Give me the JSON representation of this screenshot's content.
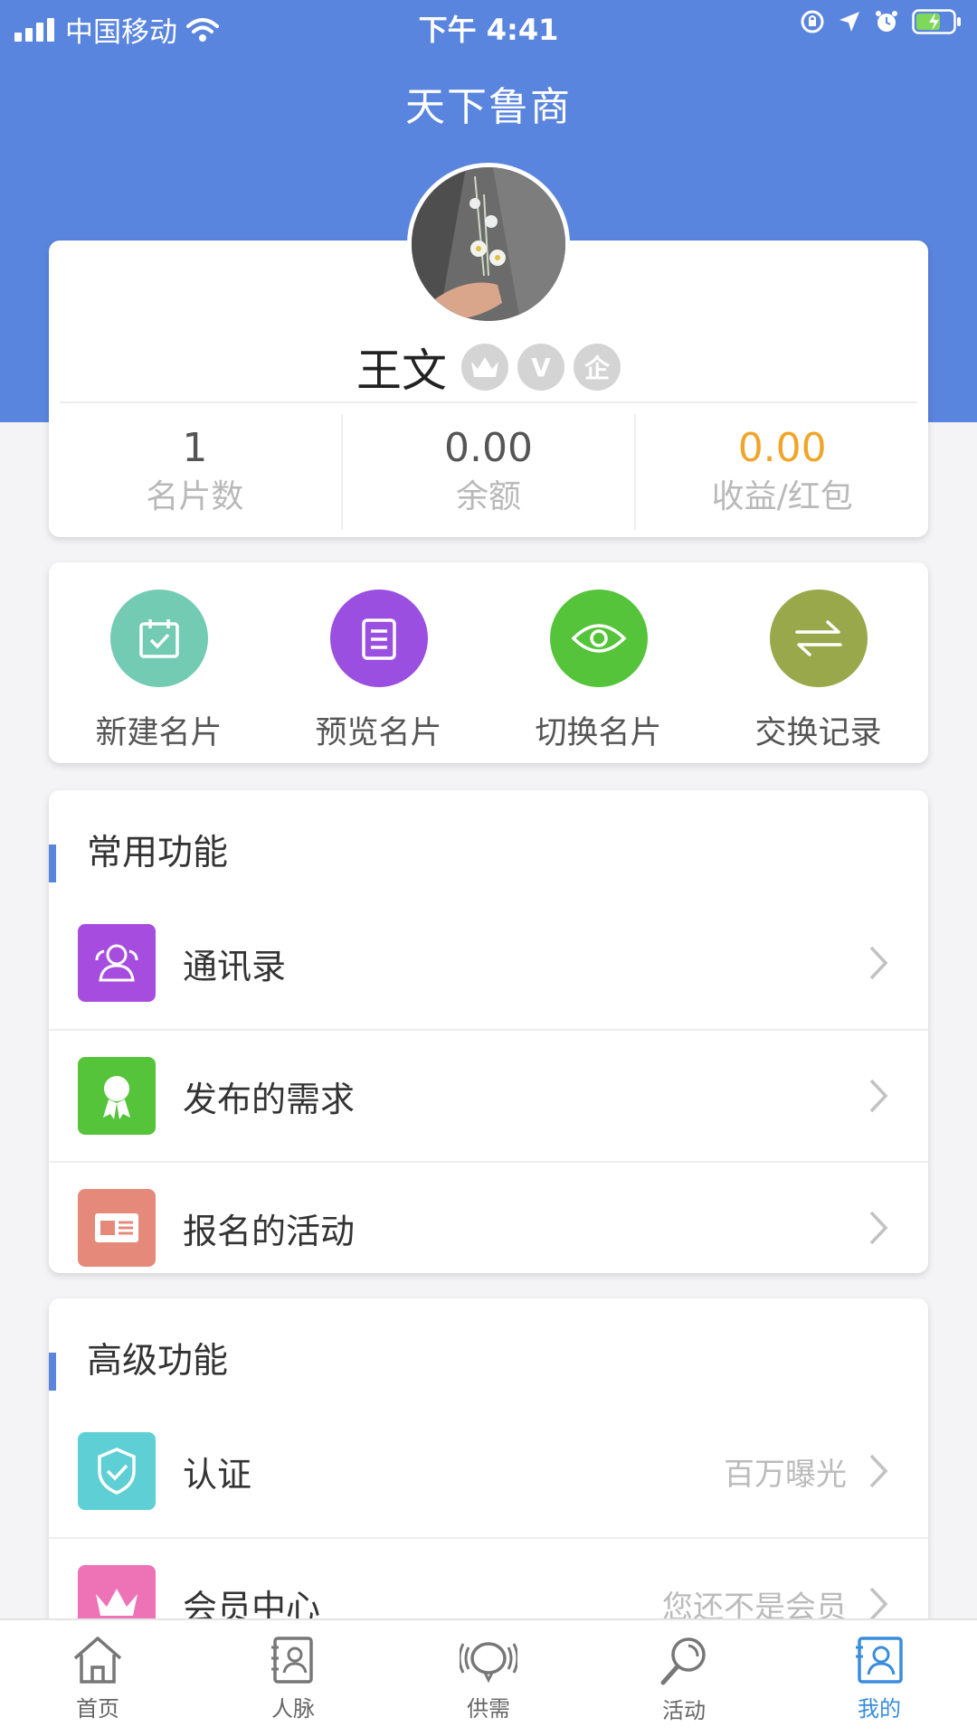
{
  "status_bar": {
    "carrier": "中国移动",
    "time": "下午 4:41"
  },
  "app": {
    "title": "天下鲁商"
  },
  "profile": {
    "name": "王文",
    "badges": [
      "crown",
      "V",
      "企"
    ],
    "stats": [
      {
        "value": "1",
        "label": "名片数"
      },
      {
        "value": "0.00",
        "label": "余额"
      },
      {
        "value": "0.00",
        "label": "收益/红包"
      }
    ],
    "accent_color": "#f0a52a"
  },
  "quick_actions": [
    {
      "label": "新建名片",
      "icon": "calendar-check-icon",
      "color": "#74cbb4"
    },
    {
      "label": "预览名片",
      "icon": "document-icon",
      "color": "#9b4fe0"
    },
    {
      "label": "切换名片",
      "icon": "eye-icon",
      "color": "#55c43a"
    },
    {
      "label": "交换记录",
      "icon": "exchange-arrows-icon",
      "color": "#98a84a"
    }
  ],
  "common": {
    "title": "常用功能",
    "items": [
      {
        "label": "通讯录",
        "icon": "contacts-icon",
        "color": "#a64de0",
        "hint": ""
      },
      {
        "label": "发布的需求",
        "icon": "award-ribbon-icon",
        "color": "#55c43a",
        "hint": ""
      },
      {
        "label": "报名的活动",
        "icon": "ticket-card-icon",
        "color": "#e58a7b",
        "hint": ""
      }
    ]
  },
  "advanced": {
    "title": "高级功能",
    "items": [
      {
        "label": "认证",
        "icon": "shield-check-icon",
        "color": "#5ecfd4",
        "hint": "百万曝光"
      },
      {
        "label": "会员中心",
        "icon": "crown-icon",
        "color": "#ee72b6",
        "hint": "您还不是会员"
      }
    ]
  },
  "tabbar": {
    "tabs": [
      {
        "label": "首页",
        "icon": "home-icon"
      },
      {
        "label": "人脉",
        "icon": "contacts-book-icon"
      },
      {
        "label": "供需",
        "icon": "chat-bubbles-icon"
      },
      {
        "label": "活动",
        "icon": "magnifier-icon"
      },
      {
        "label": "我的",
        "icon": "profile-card-icon"
      }
    ],
    "active_index": 4,
    "active_color": "#3a8ddc"
  }
}
